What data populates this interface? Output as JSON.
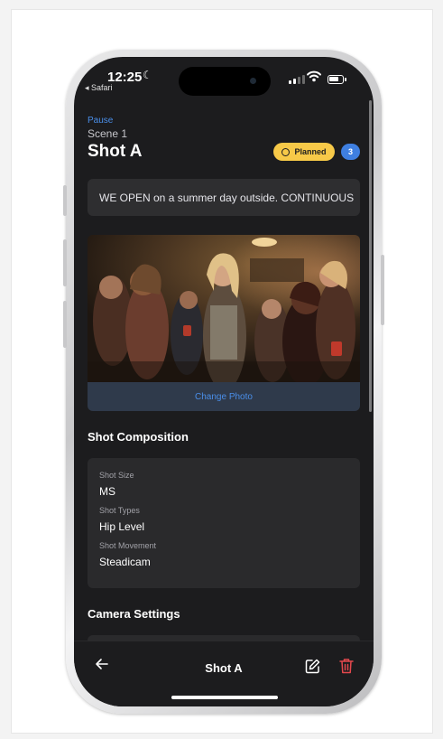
{
  "status_bar": {
    "time": "12:25",
    "back_app": "◂ Safari"
  },
  "header": {
    "back_link": "Pause",
    "scene": "Scene 1",
    "title": "Shot A",
    "status_label": "Planned",
    "count": "3"
  },
  "description": "WE OPEN on a summer day outside. CONTINUOUS",
  "photo": {
    "change_label": "Change Photo"
  },
  "shot_composition": {
    "title": "Shot Composition",
    "fields": [
      {
        "label": "Shot Size",
        "value": "MS"
      },
      {
        "label": "Shot Types",
        "value": "Hip Level"
      },
      {
        "label": "Shot Movement",
        "value": "Steadicam"
      }
    ]
  },
  "camera_settings": {
    "title": "Camera Settings"
  },
  "bottom_bar": {
    "title": "Shot A",
    "back_icon": "arrow-left-icon",
    "edit_icon": "edit-icon",
    "delete_icon": "trash-icon"
  },
  "colors": {
    "accent": "#4a8ee8",
    "status_planned": "#f7c948",
    "count_badge": "#3f7fe0",
    "delete": "#e5484d",
    "background": "#1c1c1e"
  }
}
